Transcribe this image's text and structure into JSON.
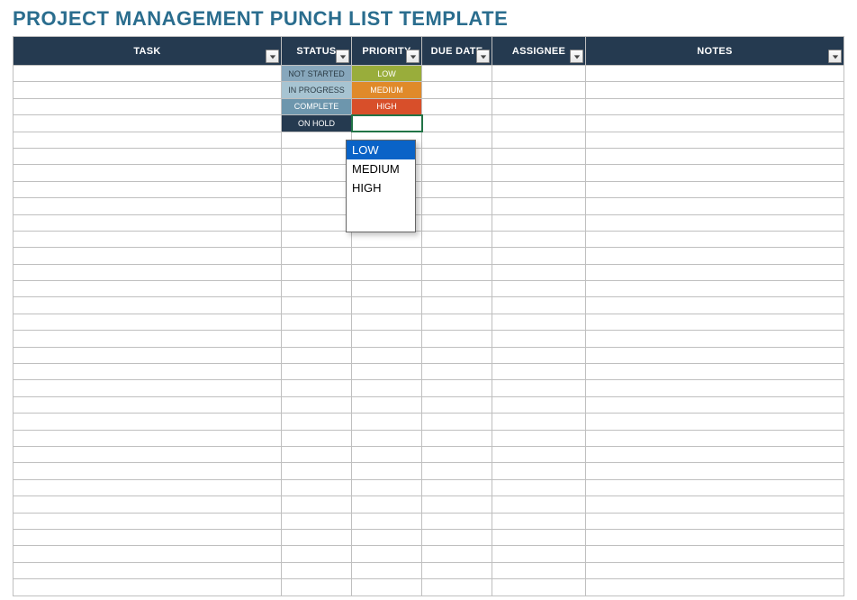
{
  "title": "PROJECT MANAGEMENT PUNCH LIST TEMPLATE",
  "columns": {
    "task": "TASK",
    "status": "STATUS",
    "priority": "PRIORITY",
    "duedate": "DUE DATE",
    "assignee": "ASSIGNEE",
    "notes": "NOTES"
  },
  "status_options": [
    "NOT STARTED",
    "IN PROGRESS",
    "COMPLETE",
    "ON HOLD"
  ],
  "priority_options": [
    "LOW",
    "MEDIUM",
    "HIGH"
  ],
  "dropdown": {
    "selected": "LOW",
    "items": [
      "LOW",
      "MEDIUM",
      "HIGH"
    ]
  },
  "rows": [
    {
      "status": "NOT STARTED",
      "status_class": "status-notstarted",
      "priority": "LOW",
      "priority_class": "priority-low"
    },
    {
      "status": "IN PROGRESS",
      "status_class": "status-inprogress",
      "priority": "MEDIUM",
      "priority_class": "priority-medium"
    },
    {
      "status": "COMPLETE",
      "status_class": "status-complete",
      "priority": "HIGH",
      "priority_class": "priority-high"
    },
    {
      "status": "ON HOLD",
      "status_class": "status-onhold",
      "priority": "",
      "priority_class": "",
      "active": true
    }
  ],
  "empty_row_count": 28,
  "colors": {
    "header_bg": "#253a50",
    "title_color": "#2a6d8e",
    "border": "#bfbfbf",
    "selection": "#217346",
    "dropdown_highlight": "#0a63c7"
  }
}
